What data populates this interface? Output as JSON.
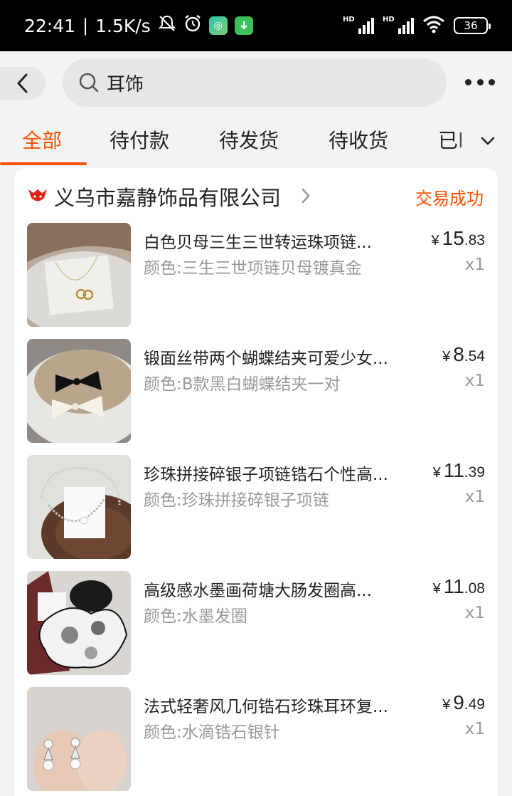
{
  "status_bar": {
    "time": "22:41",
    "net_speed": "1.5K/s",
    "battery": "36",
    "signal1_label": "HD",
    "signal2_label": "HD"
  },
  "search": {
    "query": "耳饰"
  },
  "tabs": [
    {
      "label": "全部",
      "active": true
    },
    {
      "label": "待付款",
      "active": false
    },
    {
      "label": "待发货",
      "active": false
    },
    {
      "label": "待收货",
      "active": false
    },
    {
      "label": "已l",
      "active": false
    }
  ],
  "order": {
    "shop_name": "义乌市嘉静饰品有限公司",
    "status": "交易成功",
    "items": [
      {
        "title": "白色贝母三生三世转运珠项链...",
        "spec": "颜色:三生三世项链贝母镀真金",
        "price_yen": "¥",
        "price_int": "15",
        "price_dec": ".83",
        "qty": "x1"
      },
      {
        "title": "锻面丝带两个蝴蝶结夹可爱少女...",
        "spec": "颜色:B款黑白蝴蝶结夹一对",
        "price_yen": "¥",
        "price_int": "8",
        "price_dec": ".54",
        "qty": "x1"
      },
      {
        "title": "珍珠拼接碎银子项链锆石个性高...",
        "spec": "颜色:珍珠拼接碎银子项链",
        "price_yen": "¥",
        "price_int": "11",
        "price_dec": ".39",
        "qty": "x1"
      },
      {
        "title": "高级感水墨画荷塘大肠发圈高...",
        "spec": "颜色:水墨发圈",
        "price_yen": "¥",
        "price_int": "11",
        "price_dec": ".08",
        "qty": "x1"
      },
      {
        "title": "法式轻奢风几何锆石珍珠耳环复...",
        "spec": "颜色:水滴锆石银针",
        "price_yen": "¥",
        "price_int": "9",
        "price_dec": ".49",
        "qty": "x1"
      }
    ]
  },
  "colors": {
    "accent": "#ff5000",
    "secondary_text": "#999999"
  }
}
